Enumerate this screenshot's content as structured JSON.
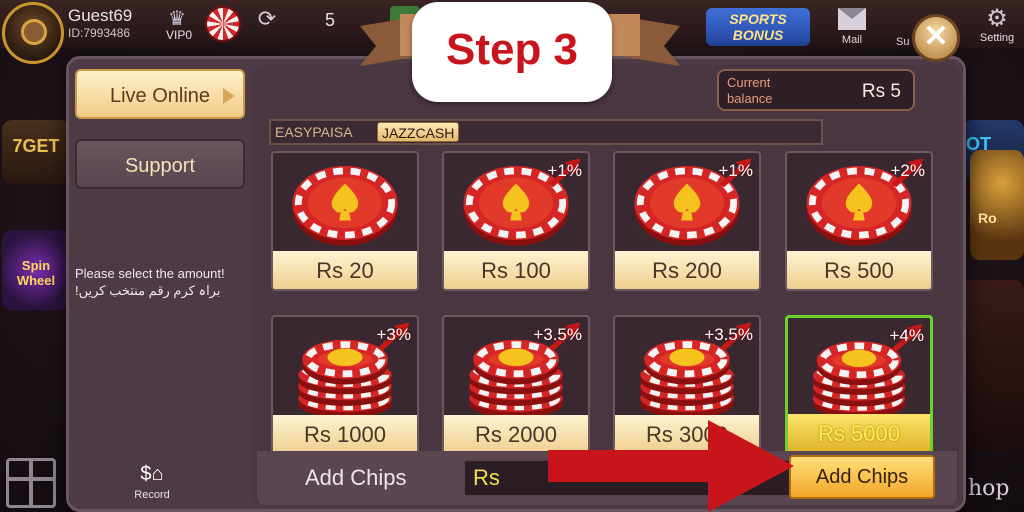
{
  "header": {
    "user_name": "Guest69",
    "user_id": "ID:7993486",
    "vip_label": "VIP0",
    "balance": "5",
    "plus_label": "+",
    "sports_bonus": "SPORTS BONUS",
    "mail_label": "Mail",
    "support_label": "Su",
    "settings_label": "Setting"
  },
  "background": {
    "left_promo": "7GET",
    "wheel_promo": "Spin Wheel",
    "right_promo": "OT",
    "right_promo2": "Ro",
    "shop_label": "hop"
  },
  "overlay": {
    "step_label": "Step 3",
    "arrow_color": "#c8141b"
  },
  "modal": {
    "sidebar": {
      "tabs": [
        {
          "label": "Live Online",
          "active": true
        },
        {
          "label": "Support",
          "active": false
        }
      ],
      "hint_en": "Please select the amount!",
      "hint_ur": "براہ کرم رقم منتخب کریں!",
      "record_label": "Record"
    },
    "balance": {
      "label": "Current balance",
      "value": "Rs  5"
    },
    "methods": [
      {
        "label": "EASYPAISA",
        "selected": false
      },
      {
        "label": "JAZZCASH",
        "selected": true
      }
    ],
    "amounts": [
      {
        "label": "Rs 20",
        "bonus": "",
        "stack": false,
        "selected": false
      },
      {
        "label": "Rs 100",
        "bonus": "+1%",
        "stack": false,
        "selected": false
      },
      {
        "label": "Rs 200",
        "bonus": "+1%",
        "stack": false,
        "selected": false
      },
      {
        "label": "Rs 500",
        "bonus": "+2%",
        "stack": false,
        "selected": false
      },
      {
        "label": "Rs 1000",
        "bonus": "+3%",
        "stack": true,
        "selected": false
      },
      {
        "label": "Rs 2000",
        "bonus": "+3.5%",
        "stack": true,
        "selected": false
      },
      {
        "label": "Rs 3000",
        "bonus": "+3.5%",
        "stack": true,
        "selected": false
      },
      {
        "label": "Rs 5000",
        "bonus": "+4%",
        "stack": true,
        "selected": true
      }
    ],
    "bottom": {
      "add_label": "Add Chips",
      "input_value": "Rs",
      "button_label": "Add Chips"
    },
    "close_icon": "close-icon"
  },
  "colors": {
    "accent_gold": "#f2cc86",
    "selected_green": "#6cd22b",
    "chip_red": "#d32a2a"
  }
}
